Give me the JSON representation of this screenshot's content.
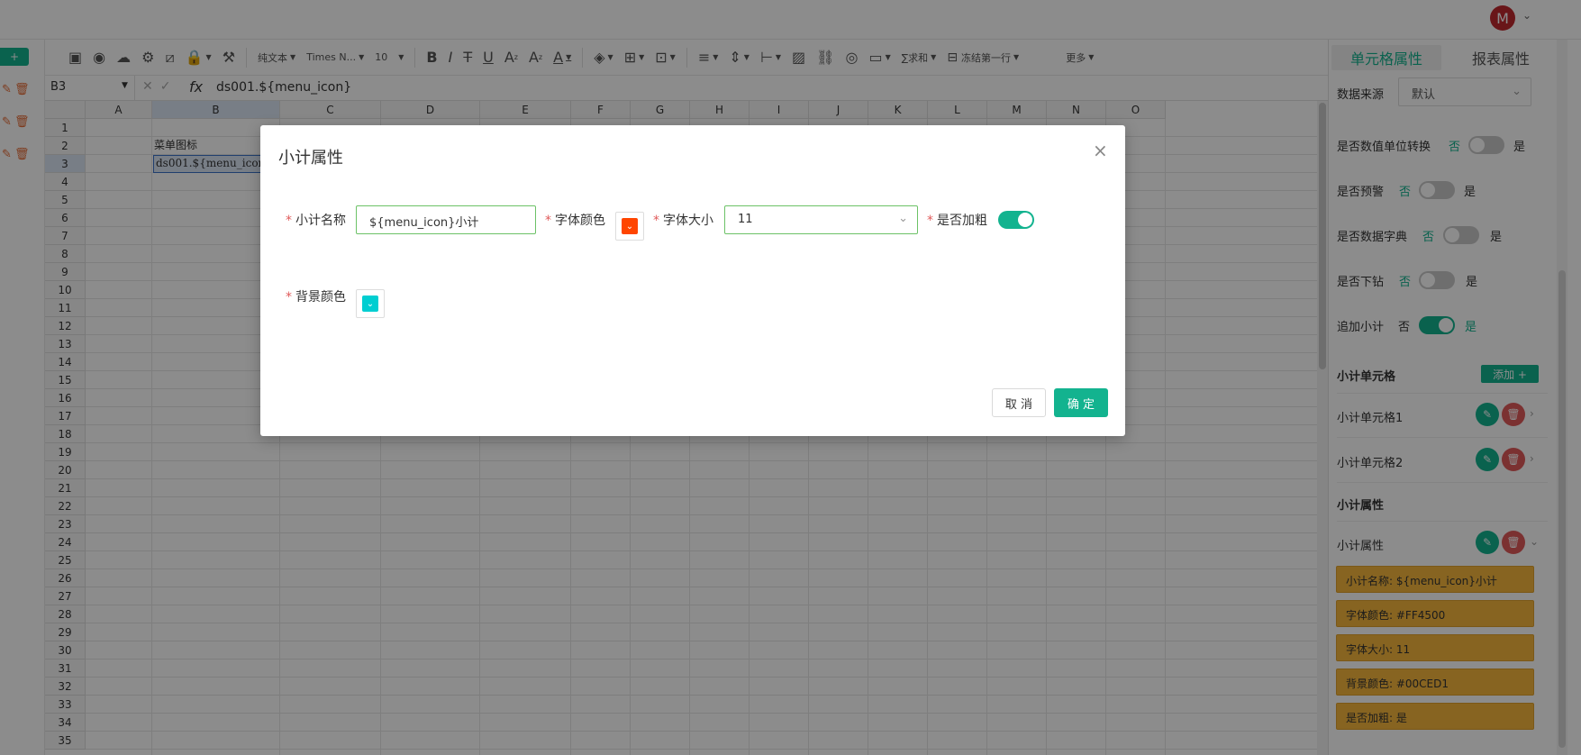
{
  "header": {
    "avatar_initial": "M",
    "avatar_caret": "⌄"
  },
  "left": {
    "add_label": "+",
    "rows": [
      "🗑",
      "🗑",
      "🗑"
    ]
  },
  "toolbar": {
    "text_format": "纯文本",
    "font_family": "Times N...",
    "font_size": "10",
    "sum_label": "∑求和",
    "freeze_label": "冻结第一行",
    "more_label": "更多"
  },
  "formula_bar": {
    "cell_ref": "B3",
    "fx": "fx",
    "formula": "ds001.${menu_icon}"
  },
  "sheet": {
    "columns": [
      "A",
      "B",
      "C",
      "D",
      "E",
      "F",
      "G",
      "H",
      "I",
      "J",
      "K",
      "L",
      "M",
      "N",
      "O"
    ],
    "rows": [
      "1",
      "2",
      "3",
      "4",
      "5",
      "6",
      "7",
      "8",
      "9",
      "10",
      "11",
      "12",
      "13",
      "14",
      "15",
      "16",
      "17",
      "18",
      "19",
      "20",
      "21",
      "22",
      "23",
      "24",
      "25",
      "26",
      "27",
      "28",
      "29",
      "30",
      "31",
      "32",
      "33",
      "34",
      "35"
    ],
    "b2": "菜单图标",
    "b3": "ds001.${menu_icon}"
  },
  "right_panel": {
    "tab_cell": "单元格属性",
    "tab_report": "报表属性",
    "data_source_label": "数据来源",
    "data_source_value": "默认",
    "no": "否",
    "yes": "是",
    "unit_convert_label": "是否数值单位转换",
    "warning_label": "是否预警",
    "dict_label": "是否数据字典",
    "drill_label": "是否下钻",
    "subtotal_label": "追加小计",
    "subtotal_cells_title": "小计单元格",
    "add_btn": "添加 +",
    "cell1": "小计单元格1",
    "cell2": "小计单元格2",
    "subtotal_props_title": "小计属性",
    "props_item": "小计属性",
    "chips": [
      "小计名称: ${menu_icon}小计",
      "字体颜色: #FF4500",
      "字体大小: 11",
      "背景颜色: #00CED1",
      "是否加粗: 是"
    ]
  },
  "modal": {
    "title": "小计属性",
    "close": "×",
    "name_label": "小计名称",
    "name_value": "${menu_icon}小计",
    "font_color_label": "字体颜色",
    "font_color": "#FF4500",
    "font_size_label": "字体大小",
    "font_size_value": "11",
    "bold_label": "是否加粗",
    "bg_color_label": "背景颜色",
    "bg_color": "#00CED1",
    "cancel": "取 消",
    "ok": "确 定"
  },
  "colors": {
    "accent": "#13B38F",
    "danger": "#E05A5A",
    "chip": "#F6B63C"
  }
}
